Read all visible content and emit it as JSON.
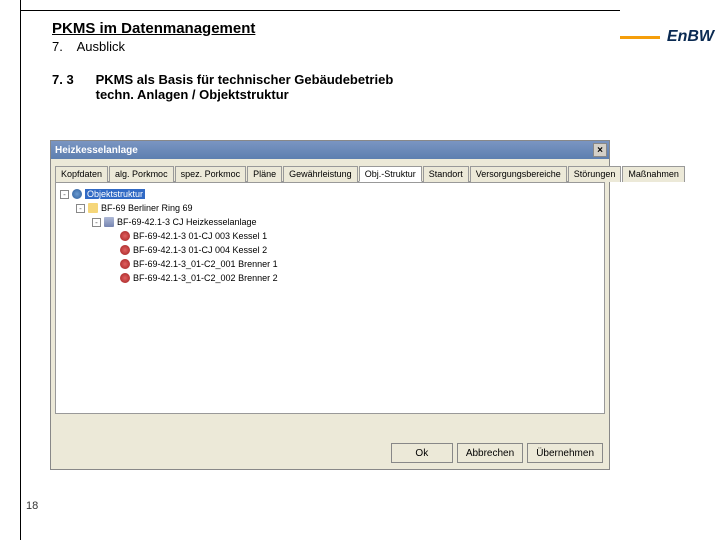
{
  "header": {
    "title": "PKMS im Datenmanagement",
    "subtitle_num": "7.",
    "subtitle_txt": "Ausblick"
  },
  "section": {
    "num": "7. 3",
    "line1": "PKMS als Basis für technischer Gebäudebetrieb",
    "line2": "techn. Anlagen / Objektstruktur"
  },
  "logo": "EnBW",
  "page_number": "18",
  "window": {
    "title": "Heizkesselanlage",
    "close": "×",
    "tabs": [
      "Kopfdaten",
      "alg. Porkmoc",
      "spez. Porkmoc",
      "Pläne",
      "Gewährleistung",
      "Obj.-Struktur",
      "Standort",
      "Versorgungsbereiche",
      "Störungen",
      "Maßnahmen"
    ],
    "active_tab": 5,
    "tree": [
      {
        "indent": 0,
        "icon": "globe",
        "expander": "-",
        "label": "Objektstruktur",
        "selected": true
      },
      {
        "indent": 1,
        "icon": "folder",
        "expander": "-",
        "label": "BF-69 Berliner Ring 69"
      },
      {
        "indent": 2,
        "icon": "cube",
        "expander": "-",
        "label": "BF-69-42.1-3  CJ  Heizkesselanlage"
      },
      {
        "indent": 3,
        "icon": "red",
        "expander": "",
        "label": "BF-69-42.1-3  01-CJ  003  Kessel 1"
      },
      {
        "indent": 3,
        "icon": "red",
        "expander": "",
        "label": "BF-69-42.1-3  01-CJ  004  Kessel 2"
      },
      {
        "indent": 3,
        "icon": "red",
        "expander": "",
        "label": "BF-69-42.1-3_01-C2_001 Brenner 1"
      },
      {
        "indent": 3,
        "icon": "red",
        "expander": "",
        "label": "BF-69-42.1-3_01-C2_002 Brenner 2"
      }
    ],
    "buttons": {
      "ok": "Ok",
      "cancel": "Abbrechen",
      "apply": "Übernehmen"
    }
  }
}
